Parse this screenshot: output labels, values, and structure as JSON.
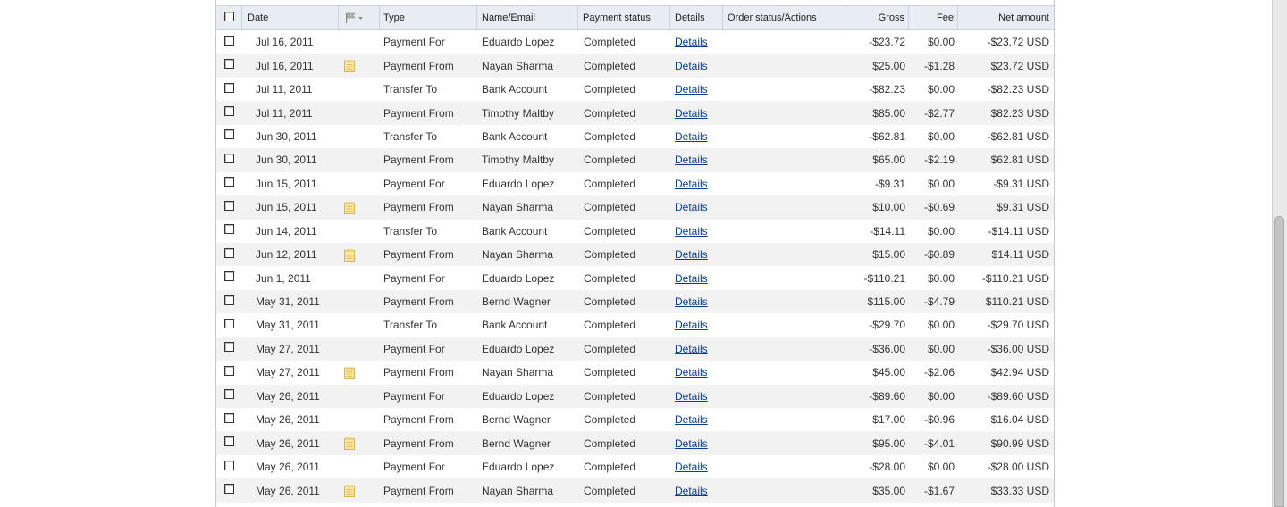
{
  "table": {
    "headers": {
      "date": "Date",
      "type": "Type",
      "name": "Name/Email",
      "status": "Payment status",
      "details": "Details",
      "order": "Order status/Actions",
      "gross": "Gross",
      "fee": "Fee",
      "net": "Net amount"
    },
    "rows": [
      {
        "date": "Jul 16, 2011",
        "note": false,
        "type": "Payment For",
        "name": "Eduardo Lopez",
        "status": "Completed",
        "details": "Details",
        "gross": "-$23.72",
        "fee": "$0.00",
        "net": "-$23.72 USD"
      },
      {
        "date": "Jul 16, 2011",
        "note": true,
        "type": "Payment From",
        "name": "Nayan Sharma",
        "status": "Completed",
        "details": "Details",
        "gross": "$25.00",
        "fee": "-$1.28",
        "net": "$23.72 USD"
      },
      {
        "date": "Jul 11, 2011",
        "note": false,
        "type": "Transfer To",
        "name": "Bank Account",
        "status": "Completed",
        "details": "Details",
        "gross": "-$82.23",
        "fee": "$0.00",
        "net": "-$82.23 USD"
      },
      {
        "date": "Jul 11, 2011",
        "note": false,
        "type": "Payment From",
        "name": "Timothy Maltby",
        "status": "Completed",
        "details": "Details",
        "gross": "$85.00",
        "fee": "-$2.77",
        "net": "$82.23 USD"
      },
      {
        "date": "Jun 30, 2011",
        "note": false,
        "type": "Transfer To",
        "name": "Bank Account",
        "status": "Completed",
        "details": "Details",
        "gross": "-$62.81",
        "fee": "$0.00",
        "net": "-$62.81 USD"
      },
      {
        "date": "Jun 30, 2011",
        "note": false,
        "type": "Payment From",
        "name": "Timothy Maltby",
        "status": "Completed",
        "details": "Details",
        "gross": "$65.00",
        "fee": "-$2.19",
        "net": "$62.81 USD"
      },
      {
        "date": "Jun 15, 2011",
        "note": false,
        "type": "Payment For",
        "name": "Eduardo Lopez",
        "status": "Completed",
        "details": "Details",
        "gross": "-$9.31",
        "fee": "$0.00",
        "net": "-$9.31 USD"
      },
      {
        "date": "Jun 15, 2011",
        "note": true,
        "type": "Payment From",
        "name": "Nayan Sharma",
        "status": "Completed",
        "details": "Details",
        "gross": "$10.00",
        "fee": "-$0.69",
        "net": "$9.31 USD"
      },
      {
        "date": "Jun 14, 2011",
        "note": false,
        "type": "Transfer To",
        "name": "Bank Account",
        "status": "Completed",
        "details": "Details",
        "gross": "-$14.11",
        "fee": "$0.00",
        "net": "-$14.11 USD"
      },
      {
        "date": "Jun 12, 2011",
        "note": true,
        "type": "Payment From",
        "name": "Nayan Sharma",
        "status": "Completed",
        "details": "Details",
        "gross": "$15.00",
        "fee": "-$0.89",
        "net": "$14.11 USD"
      },
      {
        "date": "Jun 1, 2011",
        "note": false,
        "type": "Payment For",
        "name": "Eduardo Lopez",
        "status": "Completed",
        "details": "Details",
        "gross": "-$110.21",
        "fee": "$0.00",
        "net": "-$110.21 USD"
      },
      {
        "date": "May 31, 2011",
        "note": false,
        "type": "Payment From",
        "name": "Bernd Wagner",
        "status": "Completed",
        "details": "Details",
        "gross": "$115.00",
        "fee": "-$4.79",
        "net": "$110.21 USD"
      },
      {
        "date": "May 31, 2011",
        "note": false,
        "type": "Transfer To",
        "name": "Bank Account",
        "status": "Completed",
        "details": "Details",
        "gross": "-$29.70",
        "fee": "$0.00",
        "net": "-$29.70 USD"
      },
      {
        "date": "May 27, 2011",
        "note": false,
        "type": "Payment For",
        "name": "Eduardo Lopez",
        "status": "Completed",
        "details": "Details",
        "gross": "-$36.00",
        "fee": "$0.00",
        "net": "-$36.00 USD"
      },
      {
        "date": "May 27, 2011",
        "note": true,
        "type": "Payment From",
        "name": "Nayan Sharma",
        "status": "Completed",
        "details": "Details",
        "gross": "$45.00",
        "fee": "-$2.06",
        "net": "$42.94 USD"
      },
      {
        "date": "May 26, 2011",
        "note": false,
        "type": "Payment For",
        "name": "Eduardo Lopez",
        "status": "Completed",
        "details": "Details",
        "gross": "-$89.60",
        "fee": "$0.00",
        "net": "-$89.60 USD"
      },
      {
        "date": "May 26, 2011",
        "note": false,
        "type": "Payment From",
        "name": "Bernd Wagner",
        "status": "Completed",
        "details": "Details",
        "gross": "$17.00",
        "fee": "-$0.96",
        "net": "$16.04 USD"
      },
      {
        "date": "May 26, 2011",
        "note": true,
        "type": "Payment From",
        "name": "Bernd Wagner",
        "status": "Completed",
        "details": "Details",
        "gross": "$95.00",
        "fee": "-$4.01",
        "net": "$90.99 USD"
      },
      {
        "date": "May 26, 2011",
        "note": false,
        "type": "Payment For",
        "name": "Eduardo Lopez",
        "status": "Completed",
        "details": "Details",
        "gross": "-$28.00",
        "fee": "$0.00",
        "net": "-$28.00 USD"
      },
      {
        "date": "May 26, 2011",
        "note": true,
        "type": "Payment From",
        "name": "Nayan Sharma",
        "status": "Completed",
        "details": "Details",
        "gross": "$35.00",
        "fee": "-$1.67",
        "net": "$33.33 USD"
      }
    ]
  },
  "icons": {
    "flag_filter": "flag-icon",
    "note": "note-icon",
    "checkbox": "checkbox-icon"
  },
  "colors": {
    "header_bg": "#e8edf3",
    "alt_row_bg": "#f2f2f2",
    "link": "#0b3d91",
    "note_icon": "#e9c96a"
  }
}
